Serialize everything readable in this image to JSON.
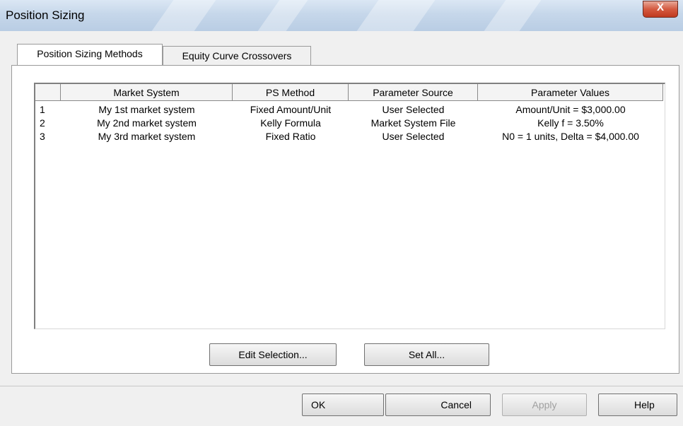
{
  "window": {
    "title": "Position Sizing",
    "close_label": "X"
  },
  "tabs": [
    {
      "label": "Position Sizing Methods",
      "active": true
    },
    {
      "label": "Equity Curve Crossovers",
      "active": false
    }
  ],
  "table": {
    "columns": [
      "",
      "Market System",
      "PS Method",
      "Parameter Source",
      "Parameter Values"
    ],
    "rows": [
      [
        "1",
        "My 1st market system",
        "Fixed Amount/Unit",
        "User Selected",
        "Amount/Unit = $3,000.00"
      ],
      [
        "2",
        "My 2nd market system",
        "Kelly Formula",
        "Market System File",
        "Kelly f = 3.50%"
      ],
      [
        "3",
        "My 3rd market system",
        "Fixed Ratio",
        "User Selected",
        "N0 = 1 units, Delta = $4,000.00"
      ]
    ]
  },
  "panel_buttons": {
    "edit": "Edit Selection...",
    "set_all": "Set All..."
  },
  "footer_buttons": {
    "ok": "OK",
    "cancel": "Cancel",
    "apply": "Apply",
    "help": "Help"
  }
}
